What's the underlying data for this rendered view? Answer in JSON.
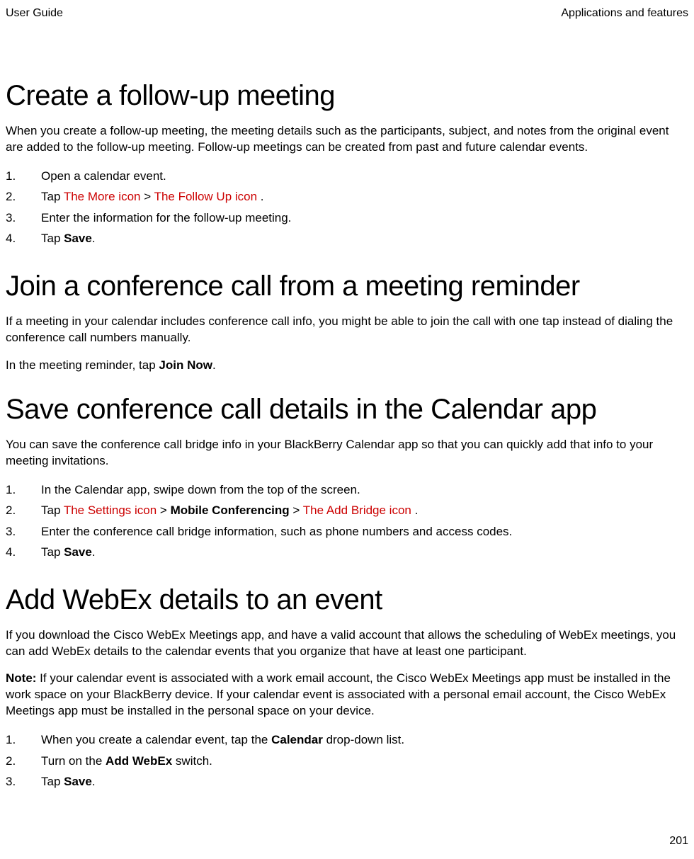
{
  "header": {
    "left": "User Guide",
    "right": "Applications and features"
  },
  "page_number": "201",
  "sections": {
    "s1": {
      "title": "Create a follow-up meeting",
      "intro": "When you create a follow-up meeting, the meeting details such as the participants, subject, and notes from the original event are added to the follow-up meeting. Follow-up meetings can be created from past and future calendar events.",
      "steps": {
        "i1": "Open a calendar event.",
        "i2_pre": "Tap ",
        "i2_icon1": " The More icon ",
        "i2_mid": " > ",
        "i2_icon2": " The Follow Up icon ",
        "i2_post": ".",
        "i3": "Enter the information for the follow-up meeting.",
        "i4_pre": "Tap ",
        "i4_bold": "Save",
        "i4_post": "."
      }
    },
    "s2": {
      "title": "Join a conference call from a meeting reminder",
      "intro": "If a meeting in your calendar includes conference call info, you might be able to join the call with one tap instead of dialing the conference call numbers manually.",
      "body_pre": "In the meeting reminder, tap ",
      "body_bold": "Join Now",
      "body_post": "."
    },
    "s3": {
      "title": "Save conference call details in the Calendar app",
      "intro": "You can save the conference call bridge info in your BlackBerry Calendar app so that you can quickly add that info to your meeting invitations.",
      "steps": {
        "i1": "In the Calendar app, swipe down from the top of the screen.",
        "i2_pre": "Tap ",
        "i2_icon1": " The Settings icon ",
        "i2_mid1": " > ",
        "i2_bold": "Mobile Conferencing",
        "i2_mid2": " > ",
        "i2_icon2": " The Add Bridge icon ",
        "i2_post": ".",
        "i3": "Enter the conference call bridge information, such as phone numbers and access codes.",
        "i4_pre": "Tap ",
        "i4_bold": "Save",
        "i4_post": "."
      }
    },
    "s4": {
      "title": "Add WebEx details to an event",
      "intro": "If you download the Cisco WebEx Meetings app, and have a valid account that allows the scheduling of WebEx meetings, you can add WebEx details to the calendar events that you organize that have at least one participant.",
      "note_label": "Note:",
      "note_body": " If your calendar event is associated with a work email account, the Cisco WebEx Meetings app must be installed in the work space on your BlackBerry device. If your calendar event is associated with a personal email account, the Cisco WebEx Meetings app must be installed in the personal space on your device.",
      "steps": {
        "i1_pre": "When you create a calendar event, tap the ",
        "i1_bold": "Calendar",
        "i1_post": " drop-down list.",
        "i2_pre": "Turn on the ",
        "i2_bold": "Add WebEx",
        "i2_post": " switch.",
        "i3_pre": "Tap ",
        "i3_bold": "Save",
        "i3_post": "."
      }
    }
  }
}
